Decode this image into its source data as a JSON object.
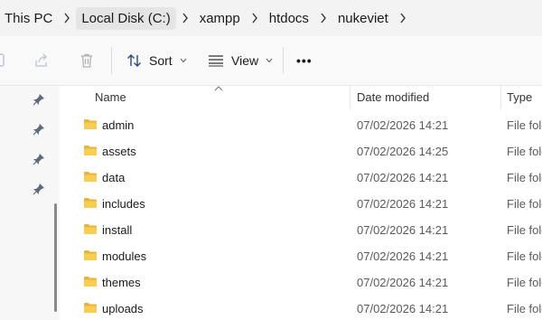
{
  "breadcrumb": {
    "items": [
      "This PC",
      "Local Disk (C:)",
      "xampp",
      "htdocs",
      "nukeviet"
    ]
  },
  "toolbar": {
    "sort_label": "Sort",
    "view_label": "View",
    "more_label": "•••"
  },
  "columns": {
    "name": "Name",
    "date_modified": "Date modified",
    "type": "Type"
  },
  "files": [
    {
      "name": "admin",
      "date": "07/02/2026 14:21",
      "type": "File folder"
    },
    {
      "name": "assets",
      "date": "07/02/2026 14:25",
      "type": "File folder"
    },
    {
      "name": "data",
      "date": "07/02/2026 14:21",
      "type": "File folder"
    },
    {
      "name": "includes",
      "date": "07/02/2026 14:21",
      "type": "File folder"
    },
    {
      "name": "install",
      "date": "07/02/2026 14:21",
      "type": "File folder"
    },
    {
      "name": "modules",
      "date": "07/02/2026 14:21",
      "type": "File folder"
    },
    {
      "name": "themes",
      "date": "07/02/2026 14:21",
      "type": "File folder"
    },
    {
      "name": "uploads",
      "date": "07/02/2026 14:21",
      "type": "File folder"
    }
  ],
  "icons": {
    "folder": "folder-icon",
    "pin": "pin-icon",
    "chevron": "chevron-right-icon"
  },
  "colors": {
    "folder": "#f5c542",
    "address_bar_bg": "#f3f3f3",
    "toolbar_bg": "#f9f9f9",
    "secondary_text": "#5a5a5a"
  }
}
